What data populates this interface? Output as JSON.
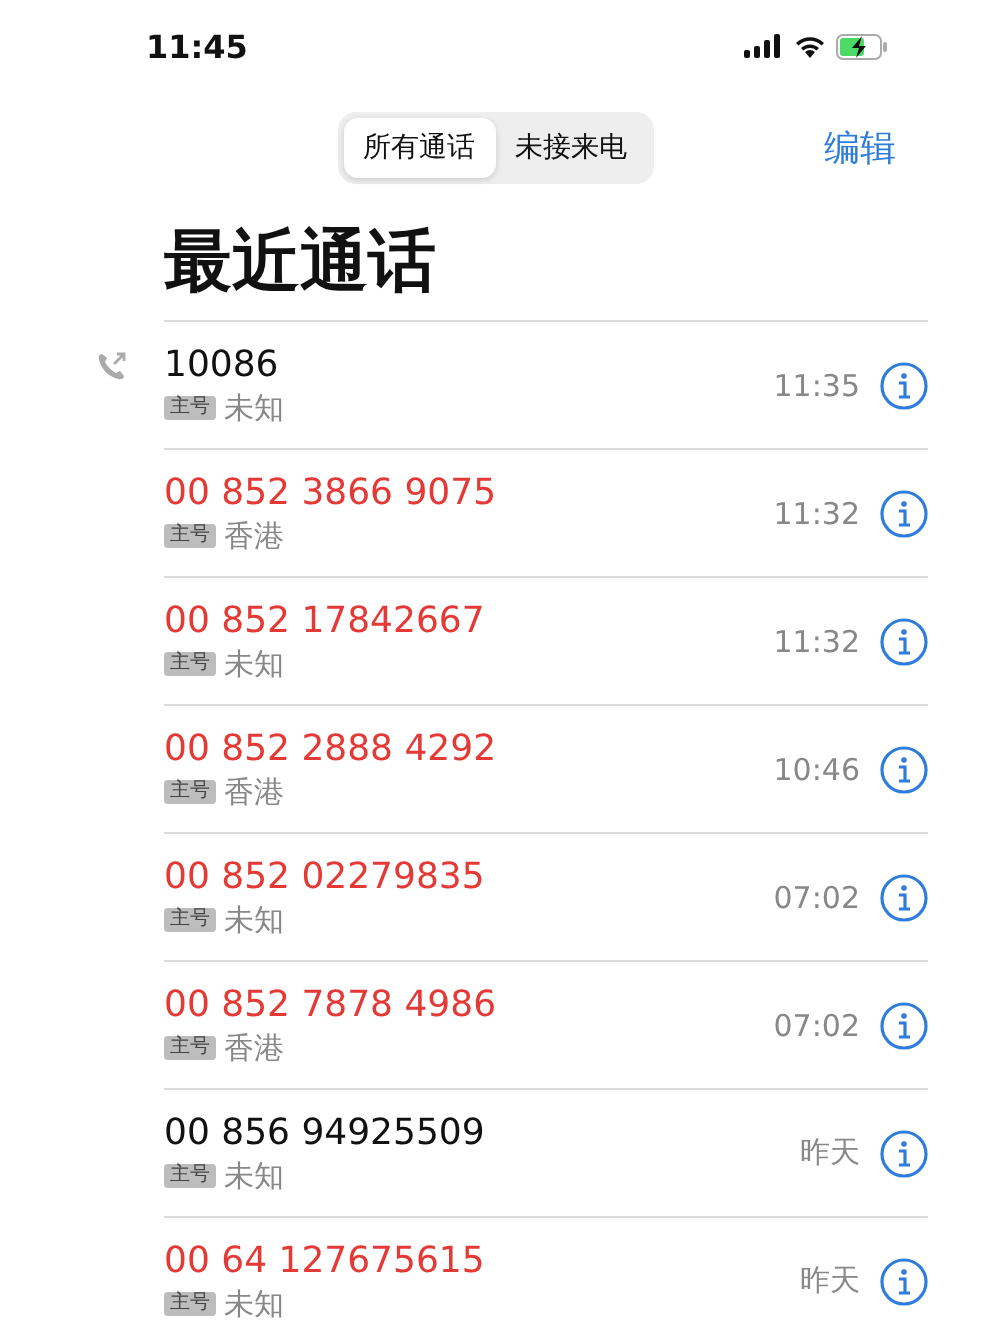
{
  "status_bar": {
    "time": "11:45",
    "battery_charging": true
  },
  "tabs": [
    {
      "label": "所有通话",
      "selected": true
    },
    {
      "label": "未接来电",
      "selected": false
    }
  ],
  "edit_button": "编辑",
  "title": "最近通话",
  "calls": [
    {
      "number": "10086",
      "badge": "主号",
      "location": "未知",
      "time": "11:35",
      "missed": false,
      "outgoing": true
    },
    {
      "number": "00 852 3866 9075",
      "badge": "主号",
      "location": "香港",
      "time": "11:32",
      "missed": true,
      "outgoing": false
    },
    {
      "number": "00 852 17842667",
      "badge": "主号",
      "location": "未知",
      "time": "11:32",
      "missed": true,
      "outgoing": false
    },
    {
      "number": "00 852 2888 4292",
      "badge": "主号",
      "location": "香港",
      "time": "10:46",
      "missed": true,
      "outgoing": false
    },
    {
      "number": "00 852 02279835",
      "badge": "主号",
      "location": "未知",
      "time": "07:02",
      "missed": true,
      "outgoing": false
    },
    {
      "number": "00 852 7878 4986",
      "badge": "主号",
      "location": "香港",
      "time": "07:02",
      "missed": true,
      "outgoing": false
    },
    {
      "number": "00 856 94925509",
      "badge": "主号",
      "location": "未知",
      "time": "昨天",
      "missed": false,
      "outgoing": false
    },
    {
      "number": "00 64 127675615",
      "badge": "主号",
      "location": "未知",
      "time": "昨天",
      "missed": true,
      "outgoing": false
    }
  ]
}
